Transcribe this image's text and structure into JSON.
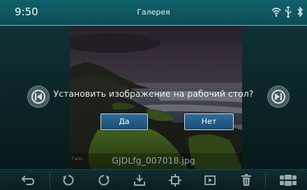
{
  "status_bar": {
    "time": "9:50",
    "title": "Галерея",
    "icons": [
      "wifi-icon",
      "usb-icon",
      "bluetooth-icon"
    ]
  },
  "dialog": {
    "message": "Установить изображение на рабочий стол?",
    "yes_label": "Да",
    "no_label": "Нет"
  },
  "photo": {
    "filename": "GJDLfg_007018.jpg",
    "small_label": "Галл.."
  },
  "navigation": {
    "prev_icon": "previous-icon",
    "next_icon": "next-icon"
  },
  "toolbar": {
    "buttons": [
      "back-icon",
      "rotate-left-icon",
      "rotate-right-icon",
      "set-wallpaper-icon",
      "crop-icon",
      "slideshow-icon",
      "delete-icon",
      "grid-icon"
    ]
  },
  "colors": {
    "status_bar": "#0f5a64",
    "dialog_button": "#245f8a",
    "accent_line": "#6fb8c0"
  }
}
